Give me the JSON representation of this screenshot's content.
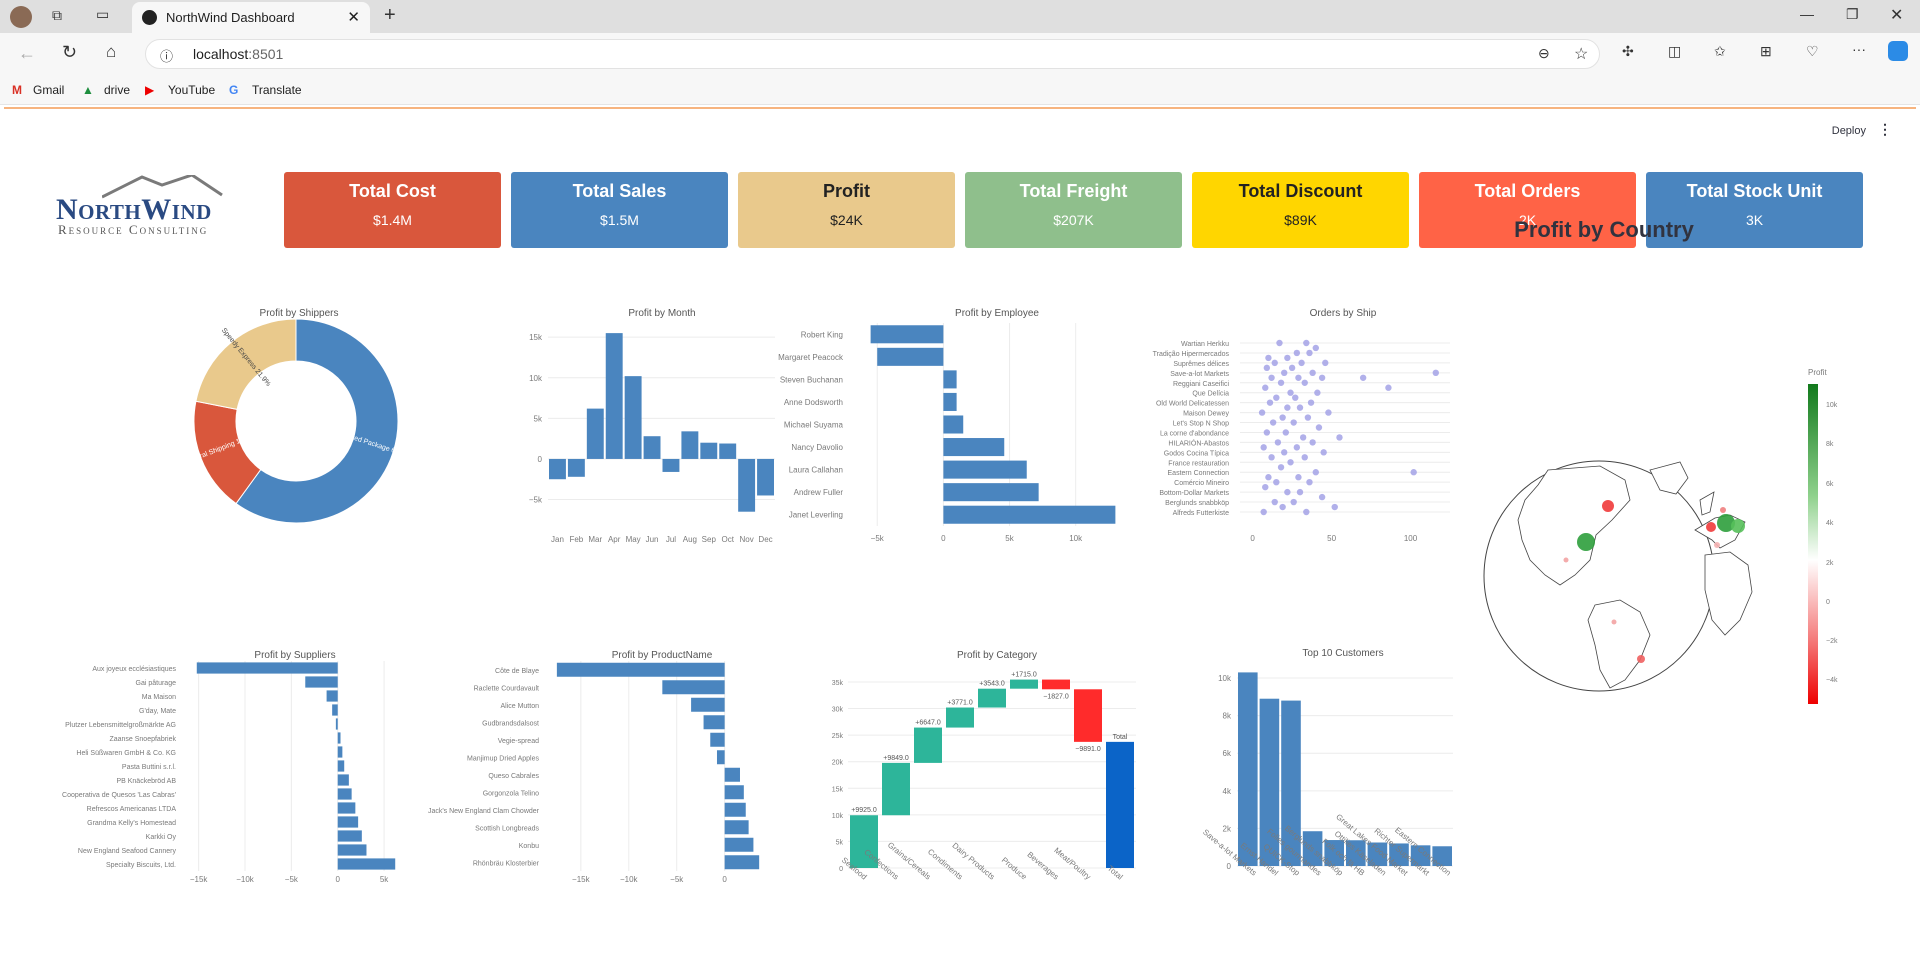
{
  "browser": {
    "tab_title": "NorthWind Dashboard",
    "url_host": "localhost",
    "url_port": ":8501",
    "bookmarks": [
      "Gmail",
      "drive",
      "YouTube",
      "Translate"
    ]
  },
  "app": {
    "deploy_label": "Deploy",
    "logo_line1": "NorthWind",
    "logo_line2": "Resource Consulting"
  },
  "kpis": [
    {
      "title": "Total Cost",
      "value": "$1.4M",
      "bg": "#d9573c",
      "fg": "#ffffff"
    },
    {
      "title": "Total Sales",
      "value": "$1.5M",
      "bg": "#4a85bf",
      "fg": "#ffffff"
    },
    {
      "title": "Profit",
      "value": "$24K",
      "bg": "#e9c98c",
      "fg": "#222222"
    },
    {
      "title": "Total Freight",
      "value": "$207K",
      "bg": "#8fbf8c",
      "fg": "#ffffff"
    },
    {
      "title": "Total Discount",
      "value": "$89K",
      "bg": "#ffd600",
      "fg": "#222222"
    },
    {
      "title": "Total Orders",
      "value": "2K",
      "bg": "#ff6346",
      "fg": "#ffffff"
    },
    {
      "title": "Total Stock Unit",
      "value": "3K",
      "bg": "#4a85bf",
      "fg": "#ffffff"
    }
  ],
  "chart_data": [
    {
      "id": "shippers",
      "type": "pie",
      "title": "Profit by Shippers",
      "labels": [
        "United Package",
        "Federal Shipping",
        "Speedy Express"
      ],
      "display": [
        "United Package 60%",
        "Federal Shipping 18.1%",
        "Speedy Express 21.9%"
      ],
      "values": [
        60,
        18.1,
        21.9
      ],
      "colors": [
        "#4a85bf",
        "#d9573c",
        "#e9c98c"
      ]
    },
    {
      "id": "month",
      "type": "bar",
      "title": "Profit by Month",
      "categories": [
        "Jan",
        "Feb",
        "Mar",
        "Apr",
        "May",
        "Jun",
        "Jul",
        "Aug",
        "Sep",
        "Oct",
        "Nov",
        "Dec"
      ],
      "values": [
        -2500,
        -2200,
        6200,
        15500,
        10200,
        2800,
        -1600,
        3400,
        2000,
        1900,
        -6500,
        -4500
      ],
      "yticks": [
        -5000,
        0,
        5000,
        10000,
        15000
      ],
      "yticklabels": [
        "−5k",
        "0",
        "5k",
        "10k",
        "15k"
      ],
      "ylim": [
        -9000,
        16500
      ]
    },
    {
      "id": "employee",
      "type": "bar",
      "title": "Profit by Employee",
      "categories": [
        "Robert King",
        "Margaret Peacock",
        "Steven Buchanan",
        "Anne Dodsworth",
        "Michael Suyama",
        "Nancy Davolio",
        "Laura Callahan",
        "Andrew Fuller",
        "Janet Leverling"
      ],
      "values": [
        -5500,
        -5000,
        1000,
        1000,
        1500,
        4600,
        6300,
        7200,
        13000
      ],
      "xticks": [
        -5000,
        0,
        5000,
        10000
      ],
      "xticklabels": [
        "−5k",
        "0",
        "5k",
        "10k"
      ],
      "xlim": [
        -6000,
        13500
      ]
    },
    {
      "id": "ship",
      "type": "scatter",
      "title": "Orders by Ship",
      "categories": [
        "Wartian Herkku",
        "Tradição Hipermercados",
        "Suprêmes délices",
        "Save-a-lot Markets",
        "Reggiani Caseifici",
        "Que Delícia",
        "Old World Delicatessen",
        "Maison Dewey",
        "Let's Stop N Shop",
        "La corne d'abondance",
        "HILARIÓN-Abastos",
        "Godos Cocina Típica",
        "France restauration",
        "Eastern Connection",
        "Comércio Mineiro",
        "Bottom-Dollar Markets",
        "Berglunds snabbköp",
        "Alfreds Futterkiste"
      ],
      "xticks": [
        0,
        50,
        100
      ],
      "xlim": [
        -8,
        125
      ],
      "points": [
        [
          17,
          0
        ],
        [
          34,
          0
        ],
        [
          40,
          0.5
        ],
        [
          28,
          1
        ],
        [
          36,
          1
        ],
        [
          10,
          1.5
        ],
        [
          22,
          1.5
        ],
        [
          14,
          2
        ],
        [
          31,
          2
        ],
        [
          46,
          2
        ],
        [
          9,
          2.5
        ],
        [
          25,
          2.5
        ],
        [
          20,
          3
        ],
        [
          38,
          3
        ],
        [
          116,
          3
        ],
        [
          12,
          3.5
        ],
        [
          29,
          3.5
        ],
        [
          44,
          3.5
        ],
        [
          70,
          3.5
        ],
        [
          18,
          4
        ],
        [
          33,
          4
        ],
        [
          86,
          4.5
        ],
        [
          8,
          4.5
        ],
        [
          24,
          5
        ],
        [
          41,
          5
        ],
        [
          15,
          5.5
        ],
        [
          27,
          5.5
        ],
        [
          37,
          6
        ],
        [
          11,
          6
        ],
        [
          22,
          6.5
        ],
        [
          30,
          6.5
        ],
        [
          48,
          7
        ],
        [
          6,
          7
        ],
        [
          19,
          7.5
        ],
        [
          35,
          7.5
        ],
        [
          13,
          8
        ],
        [
          26,
          8
        ],
        [
          42,
          8.5
        ],
        [
          9,
          9
        ],
        [
          21,
          9
        ],
        [
          55,
          9.5
        ],
        [
          32,
          9.5
        ],
        [
          16,
          10
        ],
        [
          38,
          10
        ],
        [
          7,
          10.5
        ],
        [
          28,
          10.5
        ],
        [
          20,
          11
        ],
        [
          45,
          11
        ],
        [
          12,
          11.5
        ],
        [
          33,
          11.5
        ],
        [
          24,
          12
        ],
        [
          18,
          12.5
        ],
        [
          40,
          13
        ],
        [
          102,
          13
        ],
        [
          10,
          13.5
        ],
        [
          29,
          13.5
        ],
        [
          15,
          14
        ],
        [
          36,
          14
        ],
        [
          8,
          14.5
        ],
        [
          22,
          15
        ],
        [
          30,
          15
        ],
        [
          44,
          15.5
        ],
        [
          14,
          16
        ],
        [
          26,
          16
        ],
        [
          52,
          16.5
        ],
        [
          19,
          16.5
        ],
        [
          34,
          17
        ],
        [
          7,
          17
        ]
      ]
    },
    {
      "id": "suppliers",
      "type": "bar",
      "title": "Profit by Suppliers",
      "categories": [
        "Aux joyeux ecclésiastiques",
        "Gai pâturage",
        "Ma Maison",
        "G'day, Mate",
        "Plutzer Lebensmittelgroßmärkte AG",
        "Zaanse Snoepfabriek",
        "Heli Süßwaren GmbH & Co. KG",
        "Pasta Buttini s.r.l.",
        "PB Knäckebröd AB",
        "Cooperativa de Quesos 'Las Cabras'",
        "Refrescos Americanas LTDA",
        "Grandma Kelly's Homestead",
        "Karkki Oy",
        "New England Seafood Cannery",
        "Specialty Biscuits, Ltd."
      ],
      "values": [
        -15200,
        -3500,
        -1200,
        -600,
        -200,
        300,
        500,
        700,
        1200,
        1500,
        1900,
        2200,
        2600,
        3100,
        6200
      ],
      "xticks": [
        -15000,
        -10000,
        -5000,
        0,
        5000
      ],
      "xticklabels": [
        "−15k",
        "−10k",
        "−5k",
        "0",
        "5k"
      ],
      "xlim": [
        -15500,
        6500
      ]
    },
    {
      "id": "product",
      "type": "bar",
      "title": "Profit by ProductName",
      "categories": [
        "Côte de Blaye",
        "Raclette Courdavault",
        "Alice Mutton",
        "Gudbrandsdalsost",
        "Vegie-spread",
        "Manjimup Dried Apples",
        "Queso Cabrales",
        "Gorgonzola Telino",
        "Jack's New England Clam Chowder",
        "Scottish Longbreads",
        "Konbu",
        "Rhönbräu Klosterbier"
      ],
      "values": [
        -17500,
        -6500,
        -3500,
        -2200,
        -1500,
        -800,
        1600,
        2000,
        2200,
        2500,
        3000,
        3600
      ],
      "xticks": [
        -15000,
        -10000,
        -5000,
        0
      ],
      "xticklabels": [
        "−15k",
        "−10k",
        "−5k",
        "0"
      ],
      "xlim": [
        -17800,
        4000
      ]
    },
    {
      "id": "category",
      "type": "bar",
      "title": "Profit by Category",
      "categories": [
        "Seafood",
        "Confections",
        "Grains/Cereals",
        "Condiments",
        "Dairy Products",
        "Produce",
        "Beverages",
        "Meat/Poultry",
        "Total"
      ],
      "deltas": [
        9925,
        9849,
        6647,
        3771,
        3543,
        1715,
        -1827,
        -9891,
        23732
      ],
      "labels": [
        "+9925.0",
        "+9849.0",
        "+6647.0",
        "+3771.0",
        "+3543.0",
        "+1715.0",
        "−1827.0",
        "−9891.0",
        "Total"
      ],
      "yticks": [
        0,
        5000,
        10000,
        15000,
        20000,
        25000,
        30000,
        35000
      ],
      "yticklabels": [
        "0",
        "5k",
        "10k",
        "15k",
        "20k",
        "25k",
        "30k",
        "35k"
      ],
      "ylim": [
        0,
        36500
      ]
    },
    {
      "id": "customers",
      "type": "bar",
      "title": "Top 10 Customers",
      "categories": [
        "Save-a-lot Markets",
        "Ernst Handel",
        "QUICK-Stop",
        "Folies gourmandes",
        "Berglunds snabbköp",
        "Frankenversand",
        "Ottilies Käseladen",
        "Great Lakes Food Market",
        "Richter Supermarkt",
        "Eastern Connection"
      ],
      "display_categories": [
        "Save-a-lot Markets",
        "Ernst Handel",
        "QUICK-Stop",
        "Folies gourmandes",
        "Berglunds snabbköp",
        "Folk och fä HB",
        "Ottilies Käseladen",
        "Great Lakes Food Market",
        "Richter Supermarkt",
        "Eastern Connection"
      ],
      "values": [
        10300,
        8900,
        8800,
        1850,
        1380,
        1370,
        1250,
        1200,
        1100,
        1050
      ],
      "yticks": [
        0,
        2000,
        4000,
        6000,
        8000,
        10000
      ],
      "yticklabels": [
        "0",
        "2k",
        "4k",
        "6k",
        "8k",
        "10k"
      ],
      "ylim": [
        0,
        10800
      ]
    },
    {
      "id": "country",
      "type": "map",
      "title": "Profit by Country",
      "colorbar_title": "Profit",
      "colorbar_ticks": [
        "10k",
        "8k",
        "6k",
        "4k",
        "2k",
        "0",
        "−2k",
        "−4k"
      ]
    }
  ]
}
